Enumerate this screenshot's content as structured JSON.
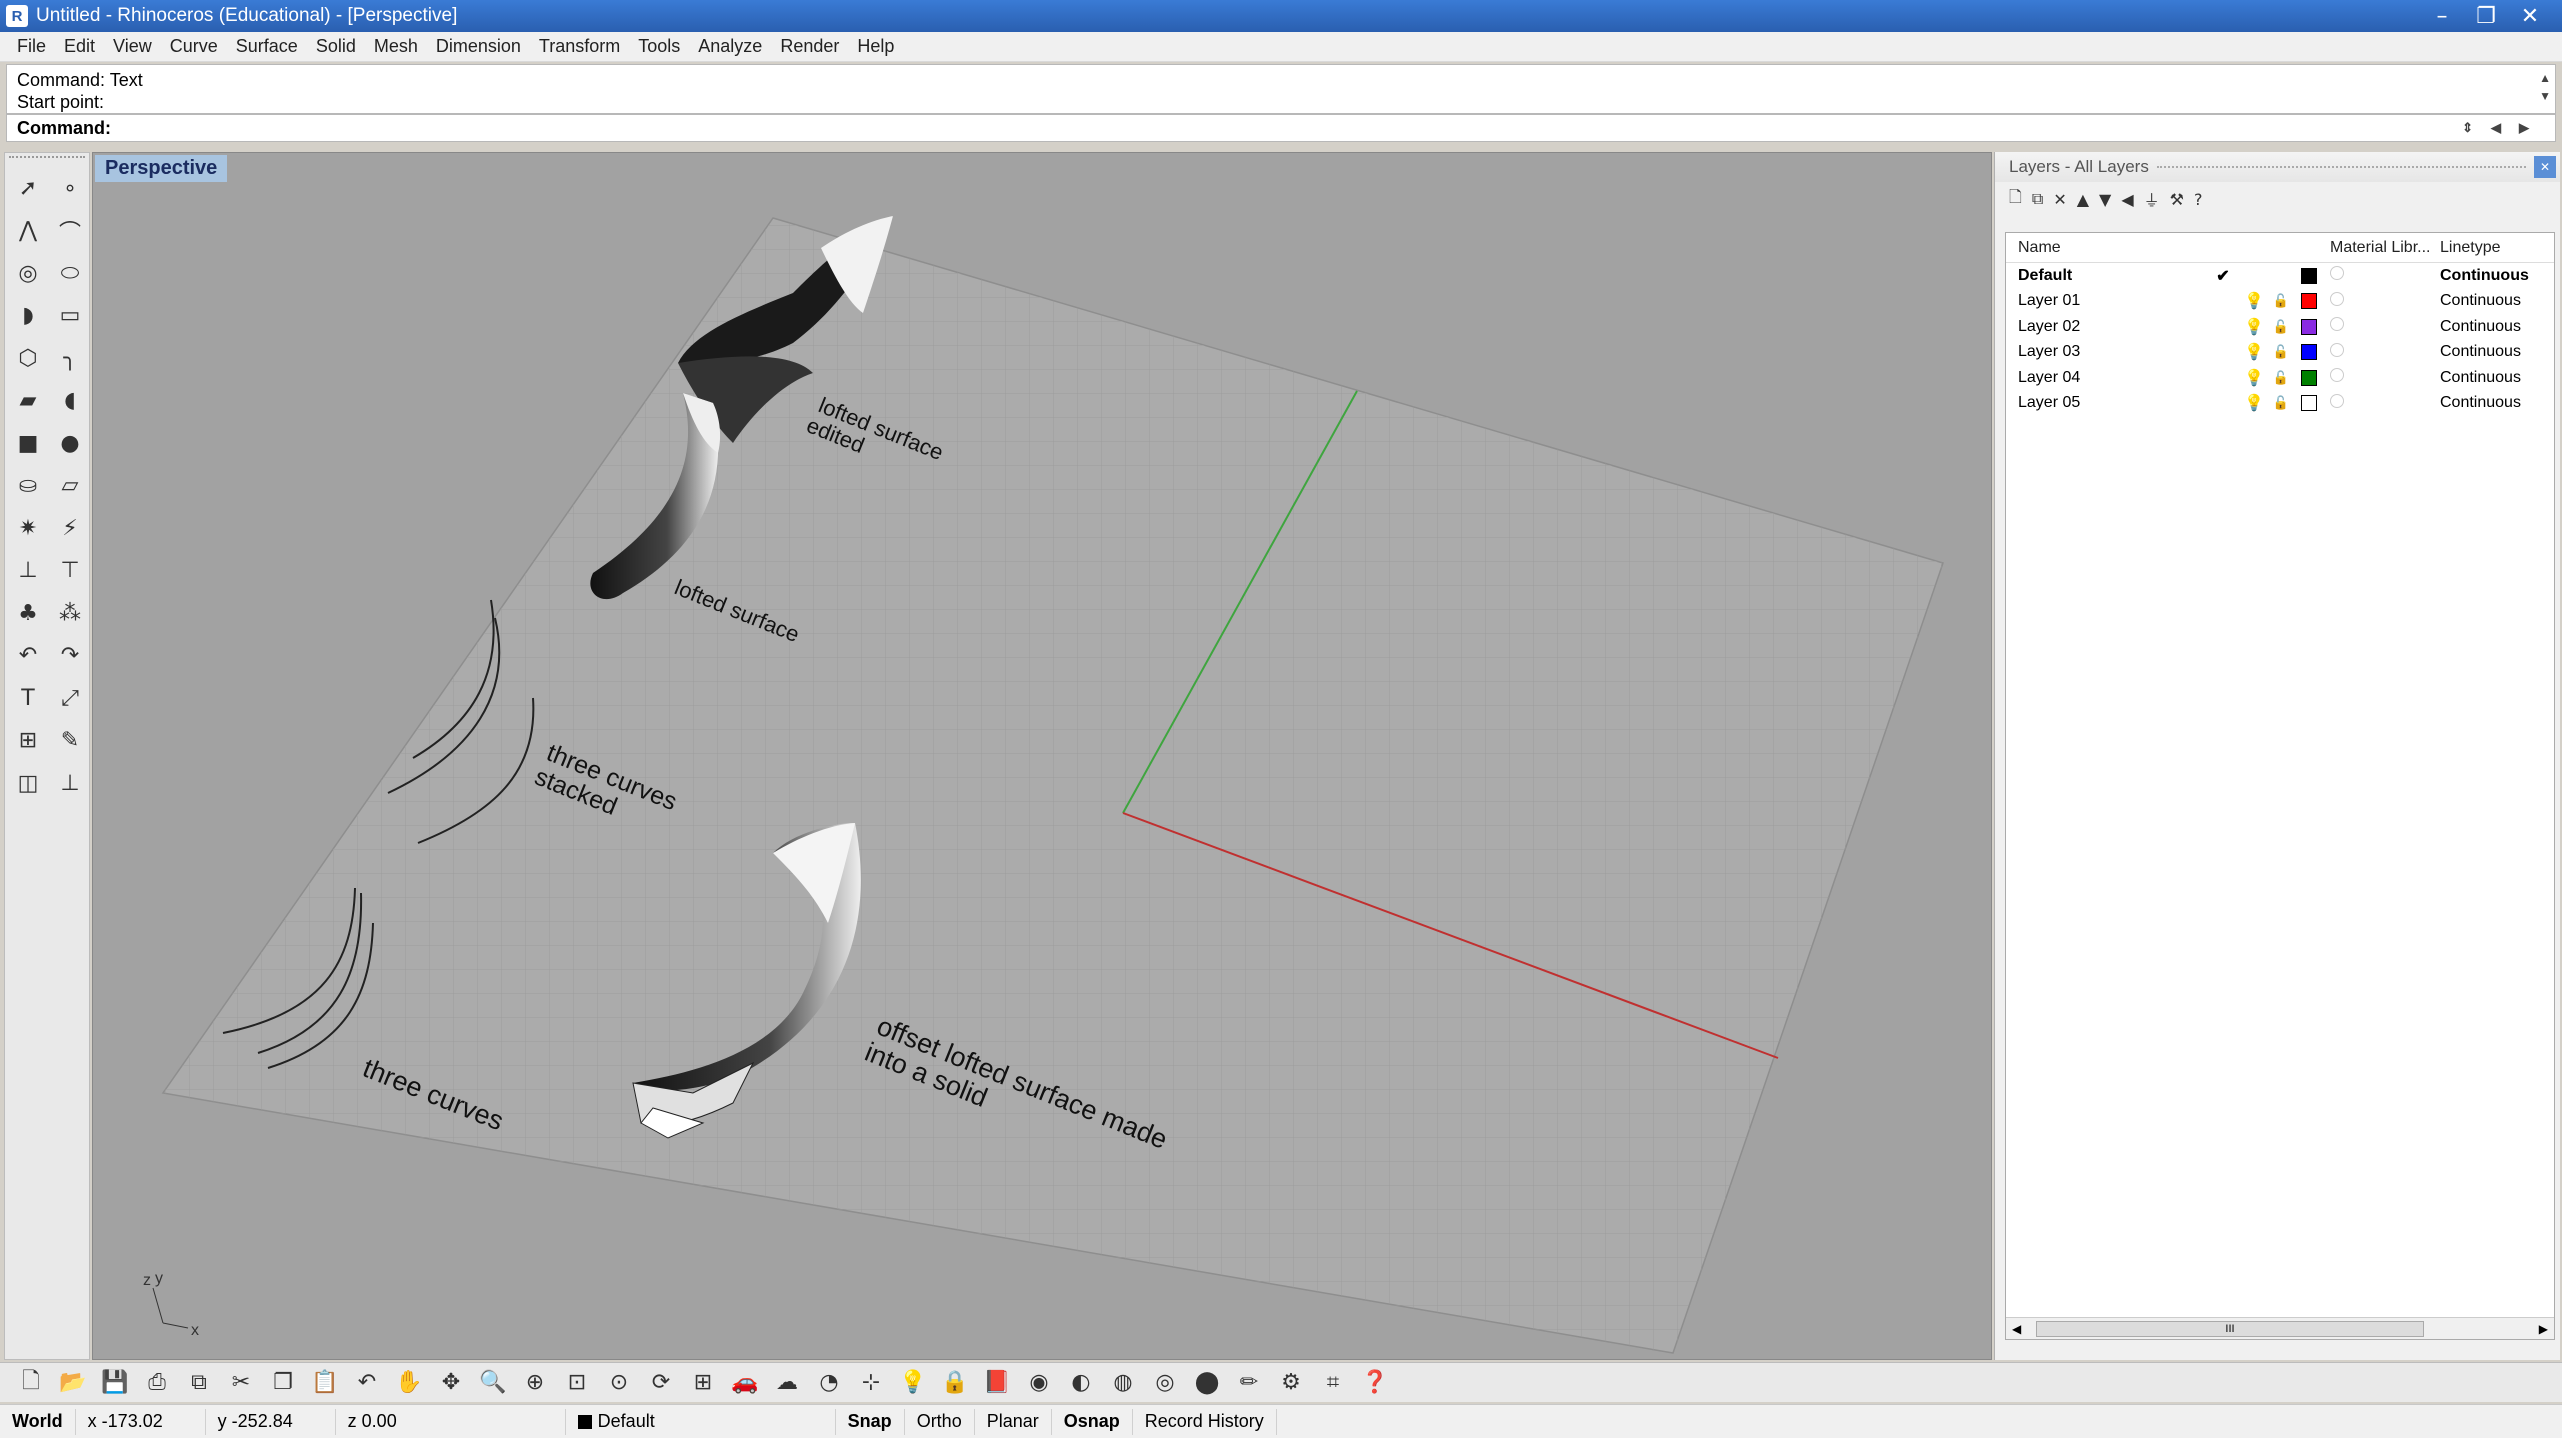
{
  "window": {
    "title": "Untitled - Rhinoceros (Educational) - [Perspective]",
    "min": "–",
    "max": "❐",
    "close": "✕"
  },
  "menu": [
    "File",
    "Edit",
    "View",
    "Curve",
    "Surface",
    "Solid",
    "Mesh",
    "Dimension",
    "Transform",
    "Tools",
    "Analyze",
    "Render",
    "Help"
  ],
  "command": {
    "history": [
      "Command: Text",
      "Start point:"
    ],
    "prompt": "Command:",
    "value": ""
  },
  "viewport": {
    "name": "Perspective",
    "labels": {
      "lofted_edited_1": "lofted surface",
      "lofted_edited_2": "edited",
      "lofted": "lofted surface",
      "stacked_1": "three curves",
      "stacked_2": "stacked",
      "three_curves": "three curves",
      "offset_1": "offset lofted surface made",
      "offset_2": "into a solid"
    },
    "axis_icon": {
      "z": "z",
      "y": "y",
      "x": "x"
    }
  },
  "layers_panel": {
    "title": "Layers - All Layers",
    "columns": {
      "name": "Name",
      "material": "Material Libr...",
      "linetype": "Linetype"
    },
    "rows": [
      {
        "name": "Default",
        "current": "✔",
        "color": "#000000",
        "linetype": "Continuous"
      },
      {
        "name": "Layer 01",
        "current": "",
        "color": "#ff0000",
        "linetype": "Continuous"
      },
      {
        "name": "Layer 02",
        "current": "",
        "color": "#8a2be2",
        "linetype": "Continuous"
      },
      {
        "name": "Layer 03",
        "current": "",
        "color": "#0000ff",
        "linetype": "Continuous"
      },
      {
        "name": "Layer 04",
        "current": "",
        "color": "#008000",
        "linetype": "Continuous"
      },
      {
        "name": "Layer 05",
        "current": "",
        "color": "#ffffff",
        "linetype": "Continuous"
      }
    ],
    "scroll_thumb": "III"
  },
  "status": {
    "cplane": "World",
    "x": "x -173.02",
    "y": "y -252.84",
    "z": "z 0.00",
    "layer": "Default",
    "snap": "Snap",
    "ortho": "Ortho",
    "planar": "Planar",
    "osnap": "Osnap",
    "record": "Record History"
  }
}
